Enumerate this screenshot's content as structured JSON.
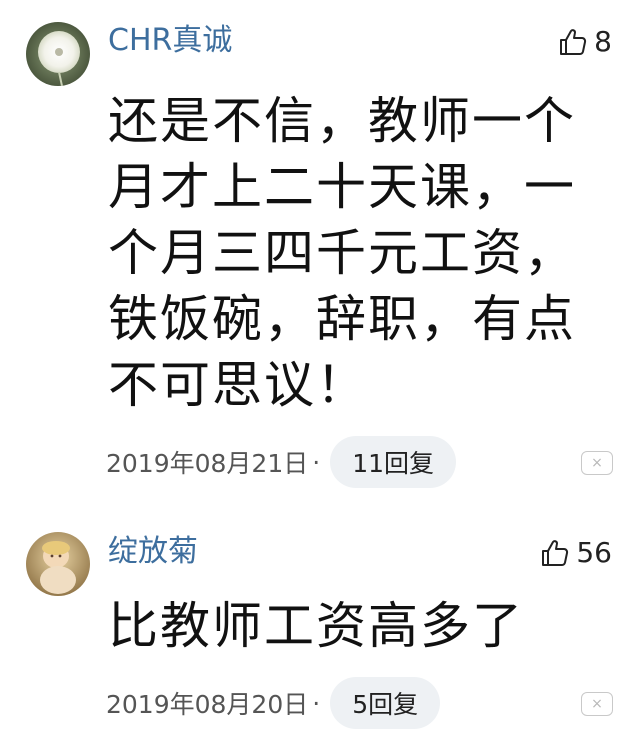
{
  "comments": [
    {
      "username": "CHR真诚",
      "avatar": "dandelion-avatar",
      "likes": "8",
      "text": "还是不信，教师一个月才上二十天课，一个月三四千元工资，铁饭碗，辞职，有点不可思议！",
      "date": "2019年08月21日",
      "separator": "·",
      "replies": "11回复",
      "close_symbol": "×"
    },
    {
      "username": "绽放菊",
      "avatar": "baby-photo-avatar",
      "likes": "56",
      "text": "比教师工资高多了",
      "date": "2019年08月20日",
      "separator": "·",
      "replies": "5回复",
      "close_symbol": "×"
    }
  ],
  "colors": {
    "username": "#3d6e9e",
    "reply_pill_bg": "#eef1f4",
    "text": "#111111"
  },
  "icons": [
    "thumb-up-icon",
    "close-icon"
  ]
}
